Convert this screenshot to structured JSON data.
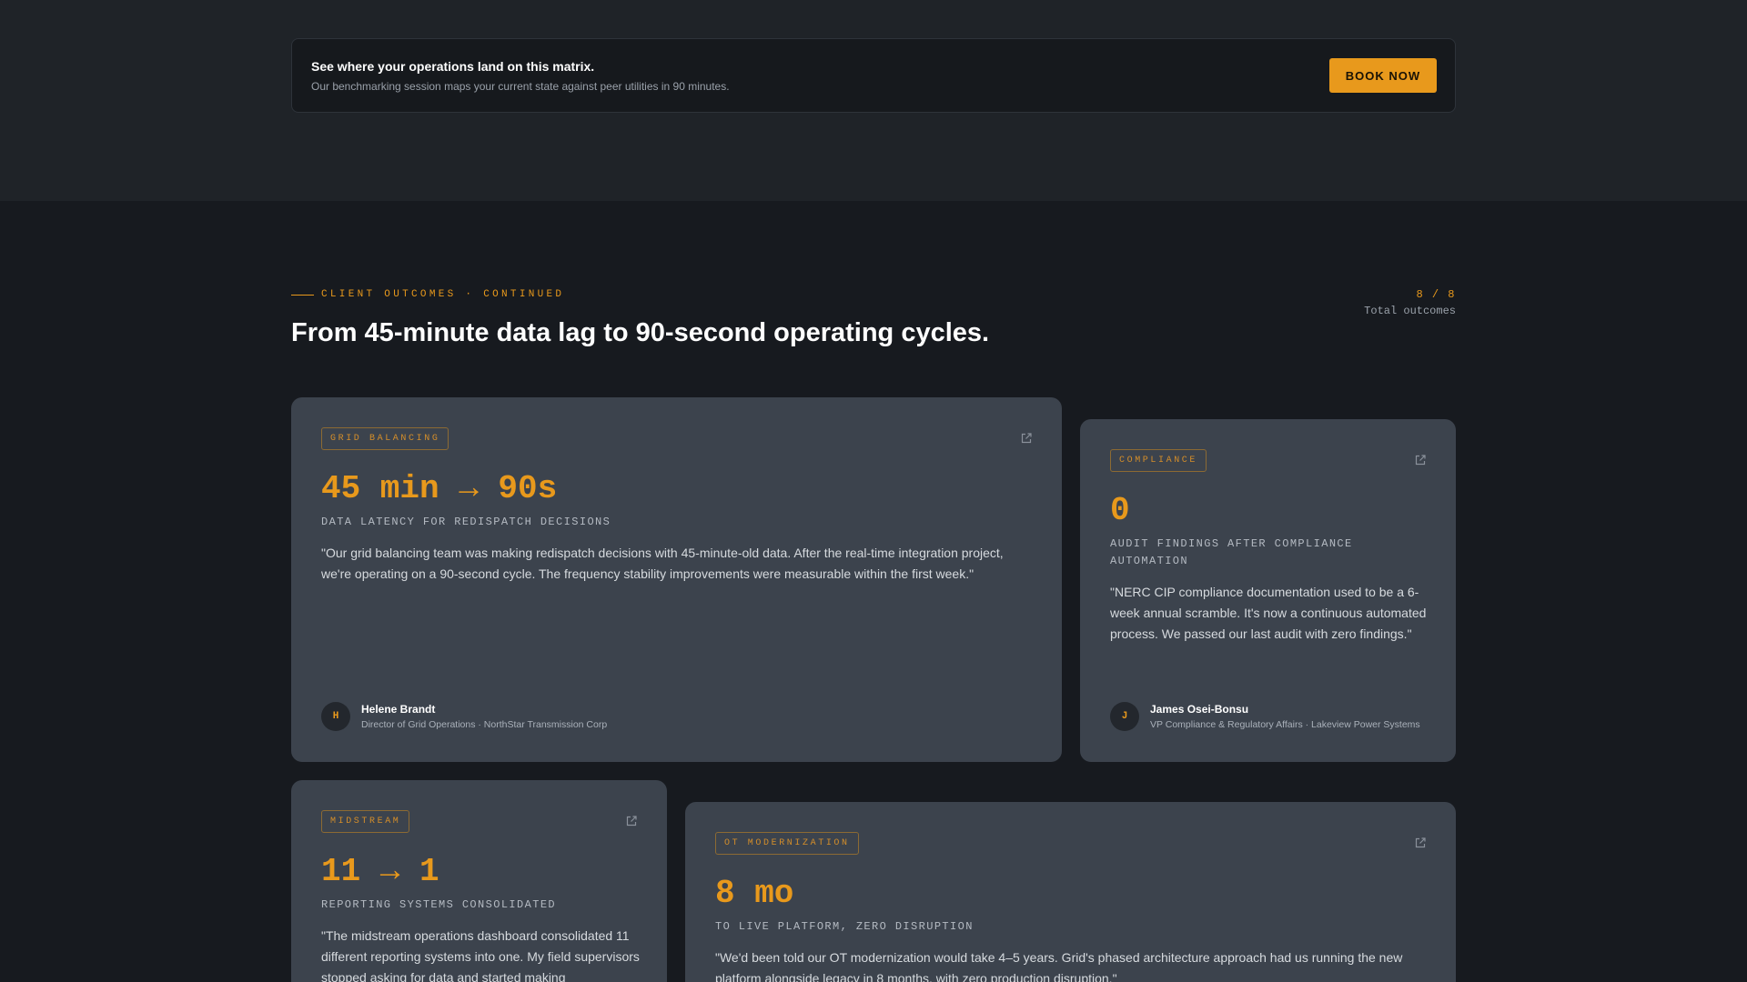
{
  "cta": {
    "title": "See where your operations land on this matrix.",
    "subtitle": "Our benchmarking session maps your current state against peer utilities in 90 minutes.",
    "button_label": "BOOK NOW"
  },
  "section": {
    "eyebrow": "CLIENT OUTCOMES · CONTINUED",
    "title": "From 45-minute data lag to 90-second operating cycles.",
    "counter_value": "8 / 8",
    "counter_label": "Total outcomes"
  },
  "cards": [
    {
      "tag": "GRID BALANCING",
      "metric": "45 min → 90s",
      "metric_label": "DATA LATENCY FOR REDISPATCH DECISIONS",
      "quote": "\"Our grid balancing team was making redispatch decisions with 45-minute-old data. After the real-time integration project, we're operating on a 90-second cycle. The frequency stability improvements were measurable within the first week.\"",
      "initial": "H",
      "name": "Helene Brandt",
      "role": "Director of Grid Operations · NorthStar Transmission Corp"
    },
    {
      "tag": "COMPLIANCE",
      "metric": "0",
      "metric_label": "AUDIT FINDINGS AFTER COMPLIANCE AUTOMATION",
      "quote": "\"NERC CIP compliance documentation used to be a 6-week annual scramble. It's now a continuous automated process. We passed our last audit with zero findings.\"",
      "initial": "J",
      "name": "James Osei-Bonsu",
      "role": "VP Compliance & Regulatory Affairs · Lakeview Power Systems"
    },
    {
      "tag": "MIDSTREAM",
      "metric": "11 → 1",
      "metric_label": "REPORTING SYSTEMS CONSOLIDATED",
      "quote": "\"The midstream operations dashboard consolidated 11 different reporting systems into one. My field supervisors stopped asking for data and started making"
    },
    {
      "tag": "OT MODERNIZATION",
      "metric": "8 mo",
      "metric_label": "TO LIVE PLATFORM, ZERO DISRUPTION",
      "quote": "\"We'd been told our OT modernization would take 4–5 years. Grid's phased architecture approach had us running the new platform alongside legacy in 8 months, with zero production disruption.\""
    }
  ],
  "icons": {
    "external": "external-link-icon"
  },
  "colors": {
    "accent": "#e8991c",
    "card": "#3c434d",
    "page": "#171a1f",
    "band": "#1f2328"
  }
}
